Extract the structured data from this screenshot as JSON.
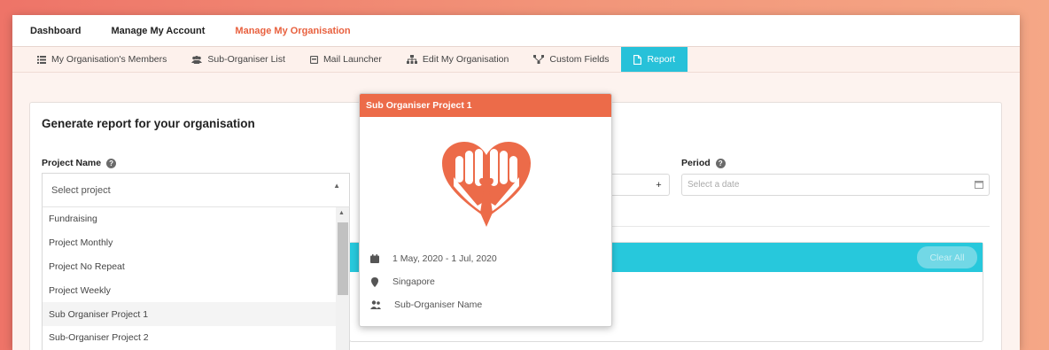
{
  "topnav": {
    "items": [
      "Dashboard",
      "Manage My Account",
      "Manage My Organisation"
    ],
    "active": "Manage My Organisation"
  },
  "subnav": {
    "tabs": [
      {
        "label": "My Organisation's Members",
        "icon": "list-icon"
      },
      {
        "label": "Sub-Organiser List",
        "icon": "users-icon"
      },
      {
        "label": "Mail Launcher",
        "icon": "mail-icon"
      },
      {
        "label": "Edit My Organisation",
        "icon": "sitemap-icon"
      },
      {
        "label": "Custom Fields",
        "icon": "fields-icon"
      },
      {
        "label": "Report",
        "icon": "file-icon"
      }
    ],
    "active": "Report"
  },
  "card": {
    "title": "Generate report for your organisation",
    "project_label": "Project Name",
    "project_placeholder": "Select project",
    "period_label": "Period",
    "period_placeholder": "Select a date",
    "plus_label": "+",
    "clear_all_label": "Clear All"
  },
  "dropdown": {
    "options": [
      "Fundraising",
      "Project Monthly",
      "Project No Repeat",
      "Project Weekly",
      "Sub Organiser Project 1",
      "Sub-Organiser Project 2"
    ],
    "highlighted": "Sub Organiser Project 1"
  },
  "popup": {
    "title": "Sub Organiser Project 1",
    "date_range": "1 May, 2020 - 1 Jul, 2020",
    "location": "Singapore",
    "organiser": "Sub-Organiser Name",
    "logo_icon": "heart-hands-logo"
  },
  "colors": {
    "accent": "#ec6b49",
    "tab_active": "#27c1d9",
    "panel_head": "#27c8dc"
  }
}
